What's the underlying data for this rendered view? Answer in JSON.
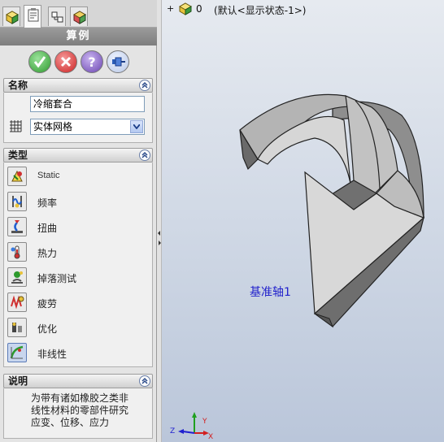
{
  "panel": {
    "title": "算例",
    "tabs": [
      "feature-manager",
      "property-manager",
      "configuration-manager",
      "display-manager"
    ],
    "actions": [
      {
        "name": "ok",
        "icon": "checkmark-icon",
        "color": "#2e9a2e"
      },
      {
        "name": "cancel",
        "icon": "x-icon",
        "color": "#cc2222"
      },
      {
        "name": "help",
        "icon": "question-icon",
        "color": "#6a44b0"
      },
      {
        "name": "pin",
        "icon": "pushpin-icon",
        "color": "#2b5db8"
      }
    ]
  },
  "name_section": {
    "header": "名称",
    "study_name": "冷缩套合",
    "mesh_type": "实体网格"
  },
  "type_section": {
    "header": "类型",
    "items": [
      {
        "label": "Static",
        "icon": "static-study-icon"
      },
      {
        "label": "频率",
        "icon": "frequency-study-icon"
      },
      {
        "label": "扭曲",
        "icon": "buckling-study-icon"
      },
      {
        "label": "热力",
        "icon": "thermal-study-icon"
      },
      {
        "label": "掉落测试",
        "icon": "drop-test-icon"
      },
      {
        "label": "疲劳",
        "icon": "fatigue-study-icon"
      },
      {
        "label": "优化",
        "icon": "optimization-study-icon"
      },
      {
        "label": "非线性",
        "icon": "nonlinear-study-icon",
        "selected": true
      }
    ]
  },
  "desc_section": {
    "header": "说明",
    "text": "为带有诸如橡胶之类非线性材料的零部件研究应变、位移、应力"
  },
  "viewport": {
    "tree_count": "0",
    "tree_config": "(默认<显示状态-1>)",
    "axis_label": "基准轴1",
    "triad": {
      "x": "X",
      "y": "Y",
      "z": "Z"
    },
    "colors": {
      "x": "#d22020",
      "y": "#20a020",
      "z": "#2020d0"
    }
  }
}
